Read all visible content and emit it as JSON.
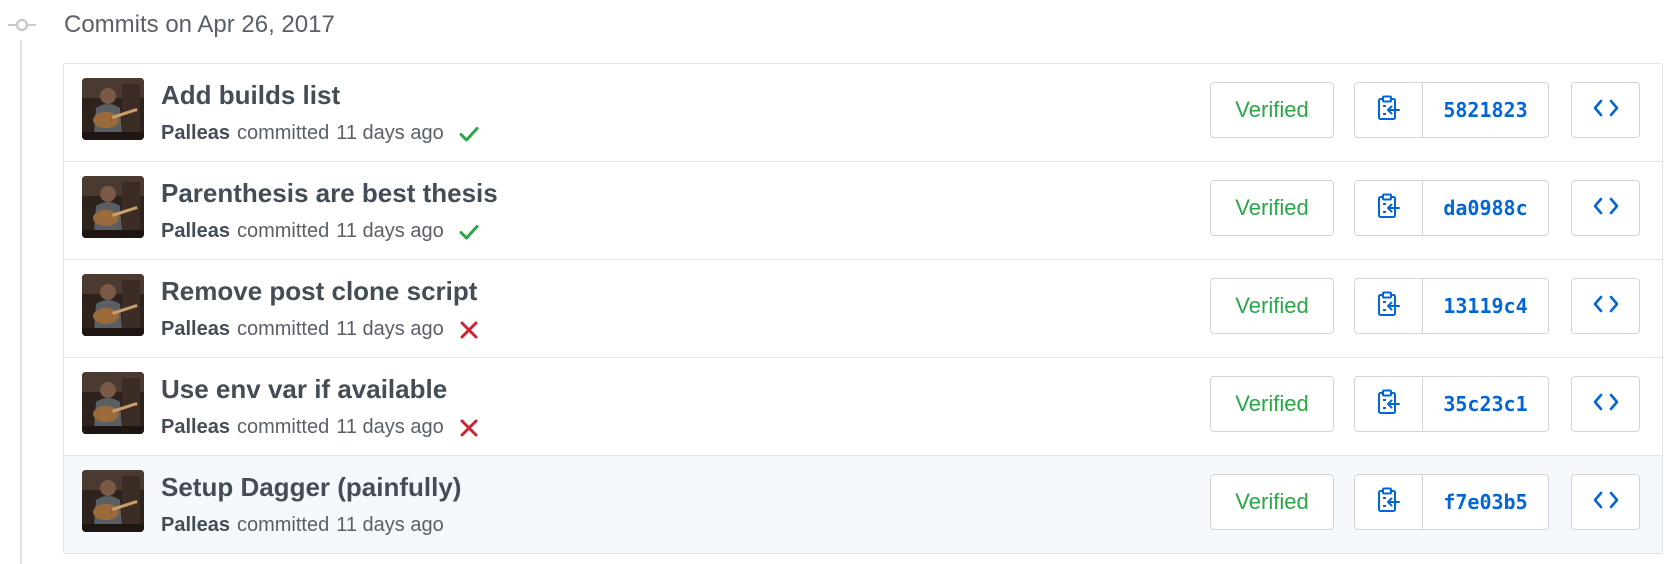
{
  "colors": {
    "verified_green": "#28a745",
    "success_check": "#28a745",
    "failure_cross": "#cb2431",
    "link_blue": "#0366d6",
    "border": "#d1d5da",
    "highlight_row": "#f5f9fd"
  },
  "group": {
    "title": "Commits on Apr 26, 2017",
    "icon": "git-commit-icon"
  },
  "commits": [
    {
      "title": "Add builds list",
      "author": "Palleas",
      "action": "committed",
      "time": "11 days ago",
      "status": "success",
      "status_icon": "check-icon",
      "verified_label": "Verified",
      "sha": "5821823",
      "copy_icon": "clippy-icon",
      "browse_icon": "code-icon",
      "highlighted": false
    },
    {
      "title": "Parenthesis are best thesis",
      "author": "Palleas",
      "action": "committed",
      "time": "11 days ago",
      "status": "success",
      "status_icon": "check-icon",
      "verified_label": "Verified",
      "sha": "da0988c",
      "copy_icon": "clippy-icon",
      "browse_icon": "code-icon",
      "highlighted": false
    },
    {
      "title": "Remove post clone script",
      "author": "Palleas",
      "action": "committed",
      "time": "11 days ago",
      "status": "failure",
      "status_icon": "x-icon",
      "verified_label": "Verified",
      "sha": "13119c4",
      "copy_icon": "clippy-icon",
      "browse_icon": "code-icon",
      "highlighted": false
    },
    {
      "title": "Use env var if available",
      "author": "Palleas",
      "action": "committed",
      "time": "11 days ago",
      "status": "failure",
      "status_icon": "x-icon",
      "verified_label": "Verified",
      "sha": "35c23c1",
      "copy_icon": "clippy-icon",
      "browse_icon": "code-icon",
      "highlighted": false
    },
    {
      "title": "Setup Dagger (painfully)",
      "author": "Palleas",
      "action": "committed",
      "time": "11 days ago",
      "status": "none",
      "status_icon": "",
      "verified_label": "Verified",
      "sha": "f7e03b5",
      "copy_icon": "clippy-icon",
      "browse_icon": "code-icon",
      "highlighted": true
    }
  ]
}
